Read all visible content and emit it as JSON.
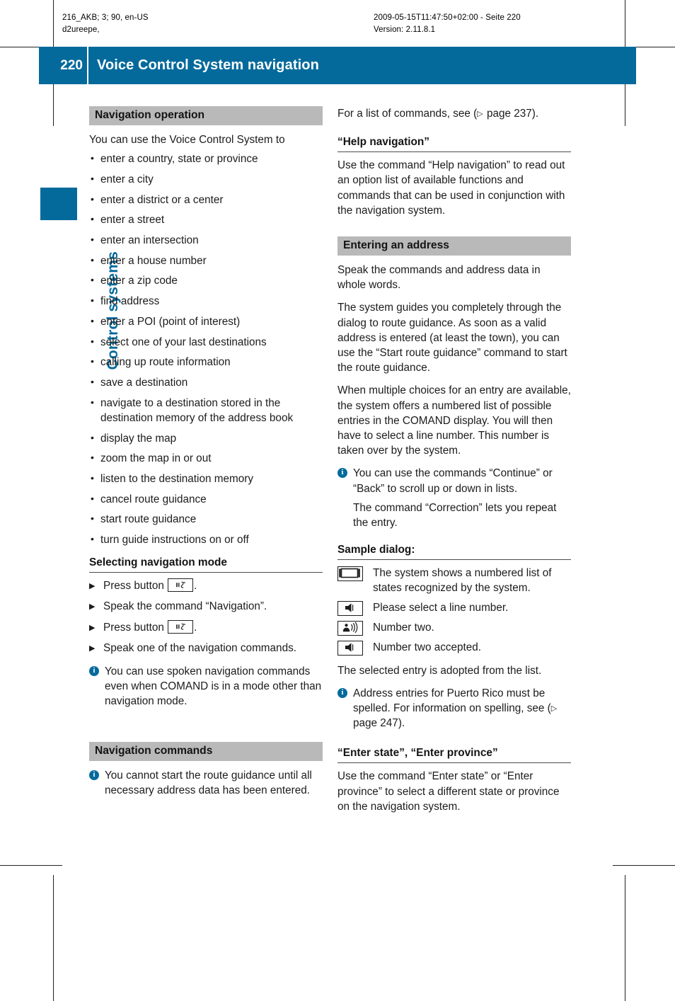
{
  "runhead": {
    "left_line1": "216_AKB; 3; 90, en-US",
    "left_line2": "d2ureepe,",
    "right_line1": "2009-05-15T11:47:50+02:00 - Seite 220",
    "right_line2": "Version: 2.11.8.1"
  },
  "banner": {
    "page_number": "220",
    "title": "Voice Control System navigation",
    "color": "#046A9C"
  },
  "thumb_tab": {
    "label": "Control systems",
    "color": "#046A9C"
  },
  "left_column": {
    "nav_operation": {
      "heading": "Navigation operation",
      "intro": "You can use the Voice Control System to",
      "bullets": [
        "enter a country, state or province",
        "enter a city",
        "enter a district or a center",
        "enter a street",
        "enter an intersection",
        "enter a house number",
        "enter a zip code",
        "find address",
        "enter a POI (point of interest)",
        "select one of your last destinations",
        "calling up route information",
        "save a destination",
        "navigate to a destination stored in the destination memory of the address book",
        "display the map",
        "zoom the map in or out",
        "listen to the destination memory",
        "cancel route guidance",
        "start route guidance",
        "turn guide instructions on or off"
      ]
    },
    "selecting_mode": {
      "heading": "Selecting navigation mode",
      "steps": [
        {
          "before": "Press button ",
          "icon": "voice-button-icon",
          "after": "."
        },
        {
          "before": "Speak the command “Navigation”.",
          "icon": null,
          "after": ""
        },
        {
          "before": "Press button ",
          "icon": "voice-button-icon",
          "after": "."
        },
        {
          "before": "Speak one of the navigation commands.",
          "icon": null,
          "after": ""
        }
      ],
      "note": "You can use spoken navigation commands even when COMAND is in a mode other than navigation mode."
    },
    "nav_commands": {
      "heading": "Navigation commands",
      "note": "You cannot start the route guidance until all necessary address data has been entered."
    }
  },
  "right_column": {
    "command_list_ref": {
      "prefix": "For a list of commands, see (",
      "triangle": "▷",
      "page_ref": " page 237",
      "suffix": ")."
    },
    "help_navigation": {
      "heading": "“Help navigation”",
      "body": "Use the command “Help navigation” to read out an option list of available functions and commands that can be used in conjunction with the navigation system."
    },
    "entering_address": {
      "heading": "Entering an address",
      "para1": "Speak the commands and address data in whole words.",
      "para2": "The system guides you completely through the dialog to route guidance. As soon as a valid address is entered (at least the town), you can use the “Start route guidance” command to start the route guidance.",
      "para3": "When multiple choices for an entry are available, the system offers a numbered list of possible entries in the COMAND display. You will then have to select a line number. This number is taken over by the system.",
      "note1": "You can use the commands “Continue” or “Back” to scroll up or down in lists.",
      "note2": "The command “Correction” lets you repeat the entry."
    },
    "sample_dialog": {
      "heading": "Sample dialog:",
      "rows": [
        {
          "icon": "display-screen-icon",
          "text": "The system shows a numbered list of states recognized by the system."
        },
        {
          "icon": "speaker-icon",
          "text": "Please select a line number."
        },
        {
          "icon": "person-speaking-icon",
          "text": "Number two."
        },
        {
          "icon": "speaker-icon",
          "text": "Number two accepted."
        }
      ],
      "closing": "The selected entry is adopted from the list.",
      "note_prefix": "Address entries for Puerto Rico must be spelled. For information on spelling, see (",
      "note_triangle": "▷",
      "note_page_ref": " page 247",
      "note_suffix": ")."
    },
    "enter_state": {
      "heading": "“Enter state”, “Enter province”",
      "body": "Use the command “Enter state” or “Enter province” to select a different state or province on the navigation system."
    }
  }
}
